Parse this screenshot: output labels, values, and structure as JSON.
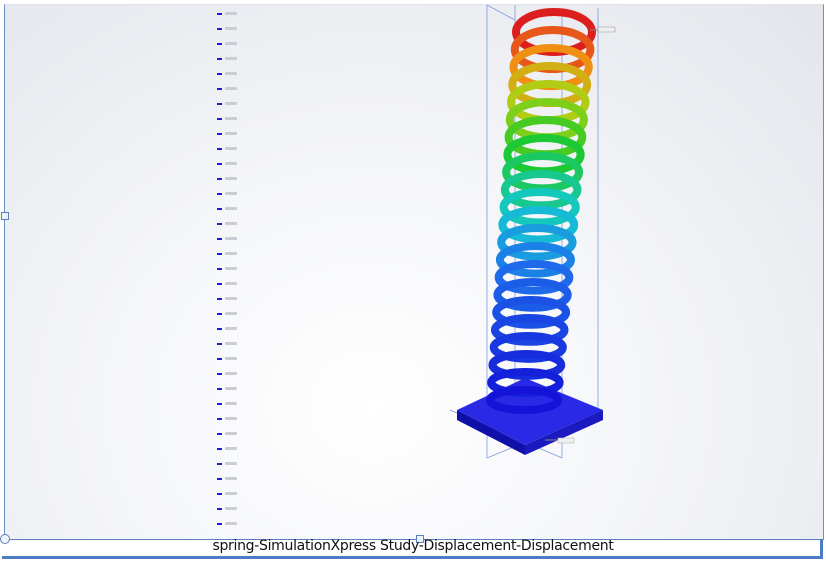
{
  "caption": "spring-SimulationXpress Study-Displacement-Displacement",
  "legend": {
    "entry_count": 35,
    "swatch_color": "#1b1bd0"
  },
  "colors": {
    "frame": "#4d7cc7",
    "max": "#d81e1e",
    "min": "#1414d8"
  },
  "spring": {
    "coil_count": 22
  }
}
